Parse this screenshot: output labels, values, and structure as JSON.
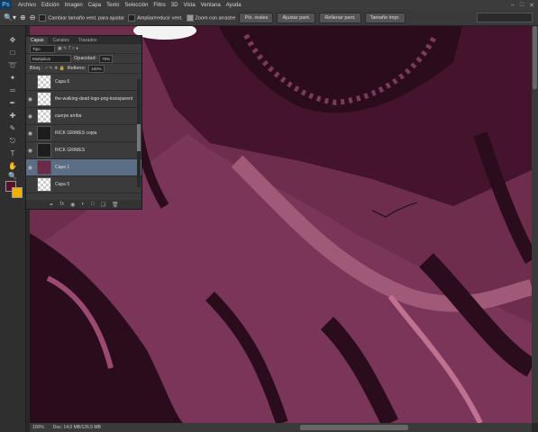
{
  "menubar": {
    "logo": "Ps",
    "items": [
      "Archivo",
      "Edición",
      "Imagen",
      "Capa",
      "Texto",
      "Selección",
      "Filtro",
      "3D",
      "Vista",
      "Ventana",
      "Ayuda"
    ]
  },
  "options": {
    "resize_windows_label": "Cambiar tamaño vent. para ajustar",
    "zoom_all_label": "Ampliar/reducir vent.",
    "scrubby_zoom_label": "Zoom con arrastre",
    "btn_100": "Píx. reales",
    "btn_fit": "Ajustar pant.",
    "btn_fill": "Rellenar pant.",
    "btn_print": "Tamaño impr."
  },
  "layers_panel": {
    "tabs": [
      "Capas",
      "Canales",
      "Trazados"
    ],
    "filter_label": "Tipo",
    "blend_mode": "Multiplicar",
    "opacity_label": "Opacidad:",
    "opacity_value": "75%",
    "lock_label": "Bloq.:",
    "fill_label": "Relleno:",
    "fill_value": "100%",
    "layers": [
      {
        "name": "Capa 6",
        "thumb": "checker",
        "selected": false,
        "visible": false
      },
      {
        "name": "the-walking-dead-logo-png-transparent",
        "thumb": "checker",
        "selected": false,
        "visible": true
      },
      {
        "name": "cuerpo arriba",
        "thumb": "checker",
        "selected": false,
        "visible": true
      },
      {
        "name": "RICK GRIMES copia",
        "thumb": "dark",
        "selected": false,
        "visible": true
      },
      {
        "name": "RICK GRIMES",
        "thumb": "dark",
        "selected": false,
        "visible": true
      },
      {
        "name": "Capa 1",
        "thumb": "face",
        "selected": true,
        "visible": true
      },
      {
        "name": "Capa 5",
        "thumb": "checker",
        "selected": false,
        "visible": false
      }
    ]
  },
  "status": {
    "zoom": "100%",
    "doc": "Doc: 14,0 MB/126,5 MB"
  },
  "colors": {
    "foreground": "#5a1028",
    "background": "#f0b000",
    "selection": "#5c6d86"
  }
}
